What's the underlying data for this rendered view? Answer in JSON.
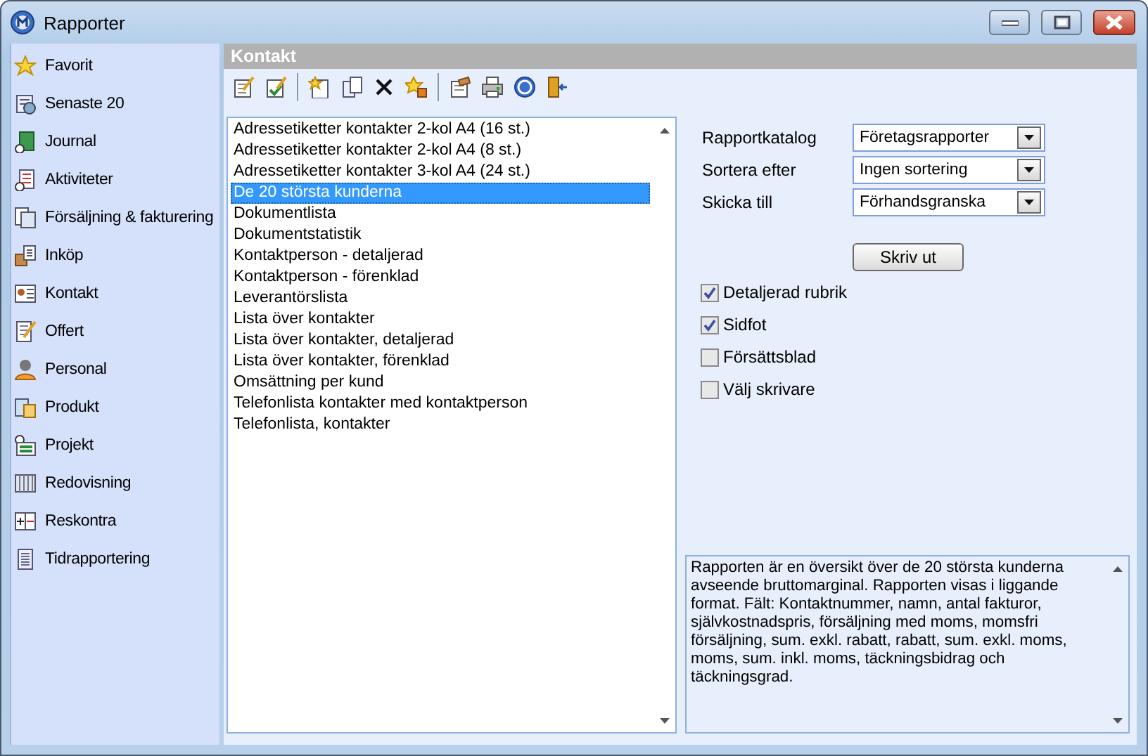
{
  "window": {
    "title": "Rapporter"
  },
  "sidebar": {
    "items": [
      {
        "label": "Favorit"
      },
      {
        "label": "Senaste 20"
      },
      {
        "label": "Journal"
      },
      {
        "label": "Aktiviteter"
      },
      {
        "label": "Försäljning & fakturering"
      },
      {
        "label": "Inköp"
      },
      {
        "label": "Kontakt"
      },
      {
        "label": "Offert"
      },
      {
        "label": "Personal"
      },
      {
        "label": "Produkt"
      },
      {
        "label": "Projekt"
      },
      {
        "label": "Redovisning"
      },
      {
        "label": "Reskontra"
      },
      {
        "label": "Tidrapportering"
      }
    ]
  },
  "panel": {
    "title": "Kontakt"
  },
  "reports": {
    "items": [
      {
        "label": "Adressetiketter kontakter 2-kol A4 (16 st.)",
        "selected": false
      },
      {
        "label": "Adressetiketter kontakter 2-kol A4 (8 st.)",
        "selected": false
      },
      {
        "label": "Adressetiketter kontakter 3-kol A4 (24 st.)",
        "selected": false
      },
      {
        "label": "De 20 största kunderna",
        "selected": true
      },
      {
        "label": "Dokumentlista",
        "selected": false
      },
      {
        "label": "Dokumentstatistik",
        "selected": false
      },
      {
        "label": "Kontaktperson - detaljerad",
        "selected": false
      },
      {
        "label": "Kontaktperson - förenklad",
        "selected": false
      },
      {
        "label": "Leverantörslista",
        "selected": false
      },
      {
        "label": "Lista över kontakter",
        "selected": false
      },
      {
        "label": "Lista över kontakter, detaljerad",
        "selected": false
      },
      {
        "label": "Lista över kontakter, förenklad",
        "selected": false
      },
      {
        "label": "Omsättning per kund",
        "selected": false
      },
      {
        "label": "Telefonlista kontakter med kontaktperson",
        "selected": false
      },
      {
        "label": "Telefonlista, kontakter",
        "selected": false
      }
    ]
  },
  "options": {
    "fields": [
      {
        "label": "Rapportkatalog",
        "value": "Företagsrapporter"
      },
      {
        "label": "Sortera efter",
        "value": "Ingen sortering"
      },
      {
        "label": "Skicka till",
        "value": "Förhandsgranska"
      }
    ],
    "print_button": "Skriv ut",
    "checkboxes": [
      {
        "label": "Detaljerad rubrik",
        "checked": true
      },
      {
        "label": "Sidfot",
        "checked": true
      },
      {
        "label": "Försättsblad",
        "checked": false
      },
      {
        "label": "Välj skrivare",
        "checked": false
      }
    ]
  },
  "description": "Rapporten är en översikt över de 20 största kunderna avseende bruttomarginal. Rapporten visas i liggande format. Fält: Kontaktnummer, namn, antal fakturor, självkostnadspris, försäljning med moms, momsfri försäljning, sum. exkl. rabatt, rabatt, sum. exkl. moms, moms, sum. inkl. moms, täckningsbidrag och täckningsgrad."
}
